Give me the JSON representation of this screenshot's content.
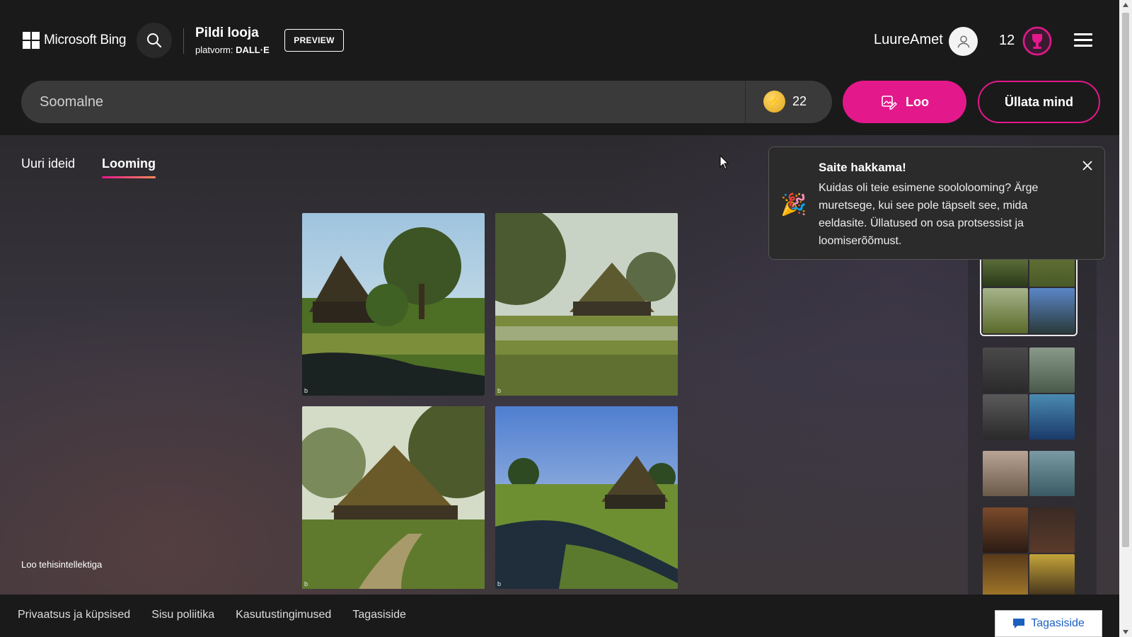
{
  "header": {
    "brand": "Microsoft Bing",
    "app_title": "Pildi looja",
    "platform_label": "platvorm:",
    "platform_name": "DALL·E",
    "preview_badge": "PREVIEW",
    "username": "LuureAmet",
    "rewards_count": "12",
    "icons": {
      "search": "search-icon",
      "avatar": "user-icon",
      "rewards": "trophy-icon",
      "menu": "hamburger-menu-icon"
    }
  },
  "prompt": {
    "value": "Soomalne",
    "boosts_remaining": "22",
    "create_label": "Loo",
    "surprise_label": "Üllata mind"
  },
  "tabs": [
    {
      "label": "Uuri ideid",
      "active": false
    },
    {
      "label": "Looming",
      "active": true
    }
  ],
  "main": {
    "footer_note": "Loo tehisintellektiga",
    "image_watermark": "b"
  },
  "toast": {
    "title": "Saite hakkama!",
    "text": "Kuidas oli teie esimene soololooming? Ärge muretsege, kui see pole täpselt see, mida eeldasite. Üllatused on osa protsessist ja loomiserõõmust."
  },
  "footer": {
    "links": [
      "Privaatsus ja küpsised",
      "Sisu poliitika",
      "Kasutustingimused",
      "Tagasiside"
    ],
    "feedback_button": "Tagasiside"
  },
  "colors": {
    "accent": "#e3188b",
    "background": "#1b1a1a"
  }
}
